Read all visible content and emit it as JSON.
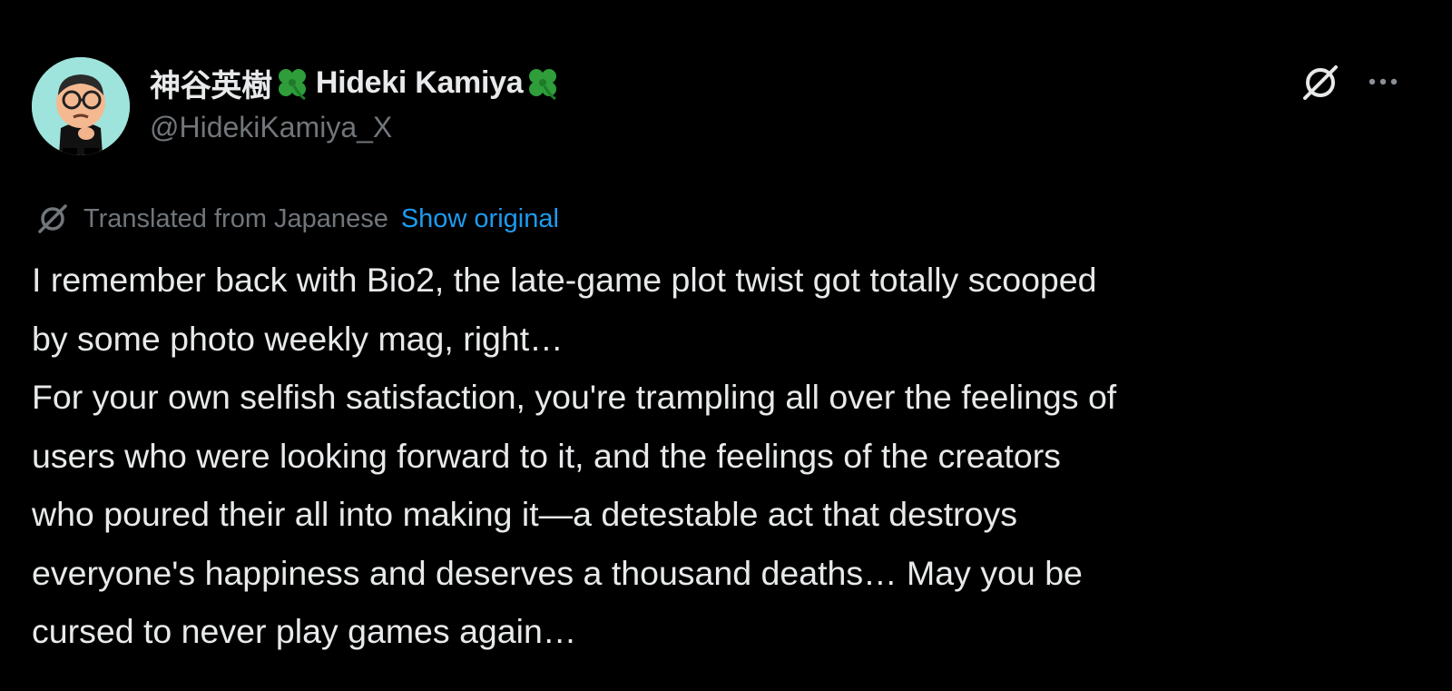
{
  "author": {
    "display_name_jp": "神谷英樹",
    "display_name_en": "Hideki Kamiya",
    "handle": "@HidekiKamiya_X",
    "badge_icon": "four-leaf-clover-emoji",
    "badge_color": "#2e9d3a",
    "avatar_background": "#9ee3dc"
  },
  "actions": {
    "grok_icon": "grok-icon",
    "more_icon": "more-horizontal-icon"
  },
  "translation": {
    "notice": "Translated from Japanese",
    "show_original_label": "Show original",
    "link_color": "#1d9bf0"
  },
  "post": {
    "lines": [
      "I remember back with Bio2, the late-game plot twist got totally scooped",
      "by some photo weekly mag, right…",
      "For your own selfish satisfaction, you're trampling all over the feelings of",
      "users who were looking forward to it, and the feelings of the creators",
      "who poured their all into making it—a detestable act that destroys",
      "everyone's happiness and deserves a thousand deaths… May you be",
      "cursed to never play games again…"
    ]
  }
}
